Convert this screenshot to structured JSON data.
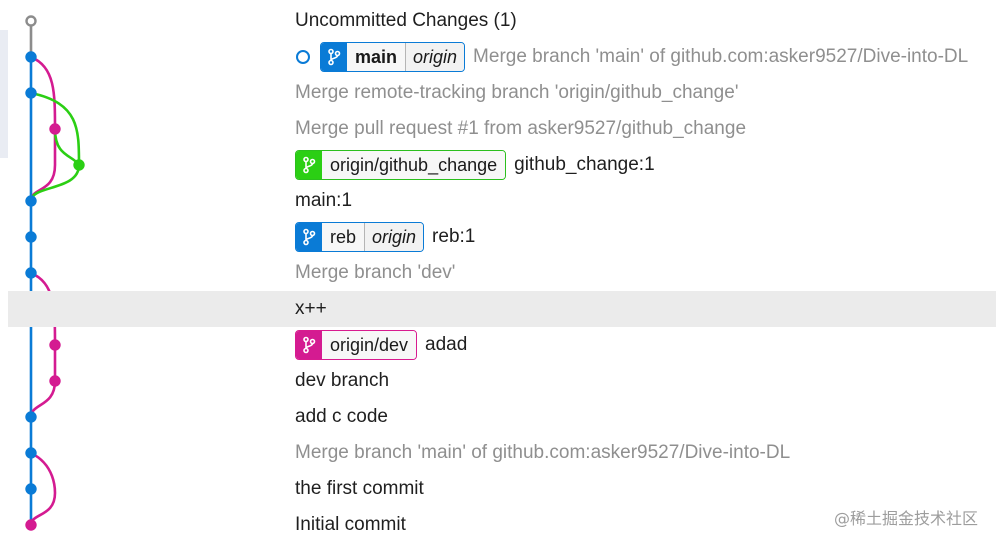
{
  "colors": {
    "blue": "#0a7bd6",
    "magenta": "#d41b91",
    "green": "#2bcf14",
    "gray": "#8c8c8c"
  },
  "icons": {
    "branch": "branch-icon",
    "head": "head-indicator-icon"
  },
  "commits": [
    {
      "message": "Uncommitted Changes (1)",
      "style": "bold"
    },
    {
      "message": "Merge branch 'main' of github.com:asker9527/Dive-into-DL",
      "style": "dim",
      "head": true,
      "ref": {
        "name": "main",
        "remote": "origin",
        "color": "blue"
      }
    },
    {
      "message": "Merge remote-tracking branch 'origin/github_change'",
      "style": "dim"
    },
    {
      "message": "Merge pull request #1 from asker9527/github_change",
      "style": "dim"
    },
    {
      "message": "github_change:1",
      "style": "normal",
      "ref": {
        "name": "origin/github_change",
        "color": "green"
      }
    },
    {
      "message": "main:1",
      "style": "normal"
    },
    {
      "message": "reb:1",
      "style": "normal",
      "ref": {
        "name": "reb",
        "remote": "origin",
        "color": "blue"
      }
    },
    {
      "message": "Merge branch 'dev'",
      "style": "dim"
    },
    {
      "message": "x++",
      "style": "normal",
      "selected": true
    },
    {
      "message": "adad",
      "style": "normal",
      "ref": {
        "name": "origin/dev",
        "color": "magenta"
      }
    },
    {
      "message": "dev branch",
      "style": "normal"
    },
    {
      "message": "add c code",
      "style": "normal"
    },
    {
      "message": "Merge branch 'main' of github.com:asker9527/Dive-into-DL",
      "style": "dim"
    },
    {
      "message": "the first commit",
      "style": "normal"
    },
    {
      "message": "Initial commit",
      "style": "normal"
    }
  ],
  "watermark": "@稀土掘金技术社区"
}
